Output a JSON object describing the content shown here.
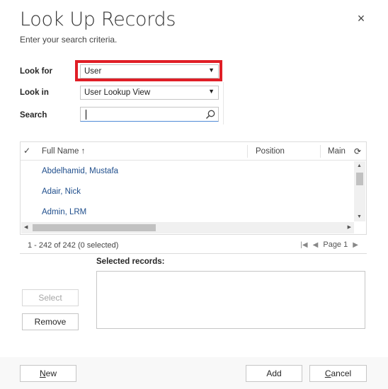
{
  "dialog": {
    "title": "Look Up Records",
    "subtitle": "Enter your search criteria.",
    "close_symbol": "×"
  },
  "form": {
    "look_for_label": "Look for",
    "look_for_value": "User",
    "look_in_label": "Look in",
    "look_in_value": "User Lookup View",
    "search_label": "Search",
    "search_value": ""
  },
  "grid": {
    "columns": {
      "full_name": "Full Name ↑",
      "position": "Position",
      "main": "Main"
    },
    "rows": [
      "Abdelhamid, Mustafa",
      "Adair, Nick",
      "Admin, LRM"
    ],
    "status": "1 - 242 of 242 (0 selected)",
    "page_label": "Page 1"
  },
  "selected": {
    "label": "Selected records:"
  },
  "buttons": {
    "select": "Select",
    "remove": "Remove",
    "new_first": "N",
    "new_rest": "ew",
    "add": "Add",
    "cancel_first": "C",
    "cancel_rest": "ancel"
  },
  "colors": {
    "highlight": "#e01e26",
    "link": "#1f4e8c"
  }
}
